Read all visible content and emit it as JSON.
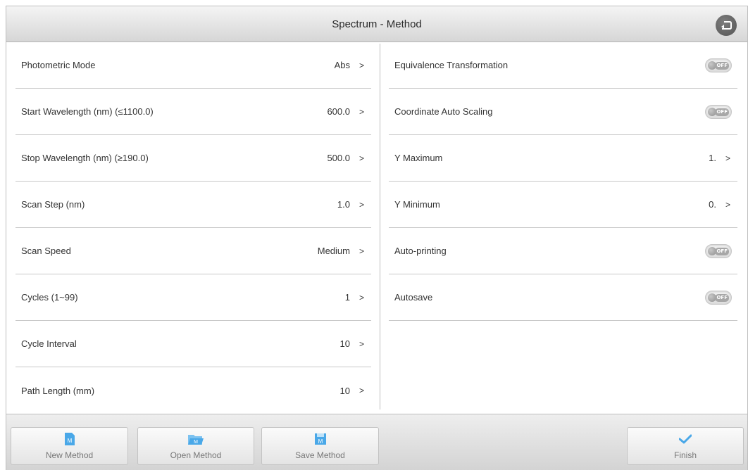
{
  "window": {
    "title": "Spectrum - Method"
  },
  "left_rows": [
    {
      "label": "Photometric Mode",
      "value": "Abs",
      "arrow": ">"
    },
    {
      "label": "Start Wavelength (nm)  (≤1100.0)",
      "value": "600.0",
      "arrow": ">"
    },
    {
      "label": "Stop Wavelength (nm)  (≥190.0)",
      "value": "500.0",
      "arrow": ">"
    },
    {
      "label": "Scan Step (nm)",
      "value": "1.0",
      "arrow": ">"
    },
    {
      "label": "Scan Speed",
      "value": "Medium",
      "arrow": ">"
    },
    {
      "label": "Cycles (1~99)",
      "value": "1",
      "arrow": ">"
    },
    {
      "label": "Cycle Interval",
      "value": "10",
      "arrow": ">"
    },
    {
      "label": "Path Length (mm)",
      "value": "10",
      "arrow": ">"
    }
  ],
  "right_rows": [
    {
      "label": "Equivalence Transformation",
      "toggle": "OFF"
    },
    {
      "label": "Coordinate Auto Scaling",
      "toggle": "OFF"
    },
    {
      "label": "Y Maximum",
      "value": "1.",
      "arrow": ">"
    },
    {
      "label": "Y Minimum",
      "value": "0.",
      "arrow": ">"
    },
    {
      "label": "Auto-printing",
      "toggle": "OFF"
    },
    {
      "label": "Autosave",
      "toggle": "OFF"
    }
  ],
  "toolbar": {
    "new_method": "New Method",
    "open_method": "Open Method",
    "save_method": "Save Method",
    "finish": "Finish",
    "icon_letter": "M"
  },
  "icons": {
    "back": "back-arrow-icon",
    "new": "new-file-icon",
    "open": "open-folder-icon",
    "save": "save-disk-icon",
    "finish": "checkmark-icon"
  },
  "colors": {
    "accent": "#4aa8e8",
    "toggle_off": "#a7a7a7"
  }
}
